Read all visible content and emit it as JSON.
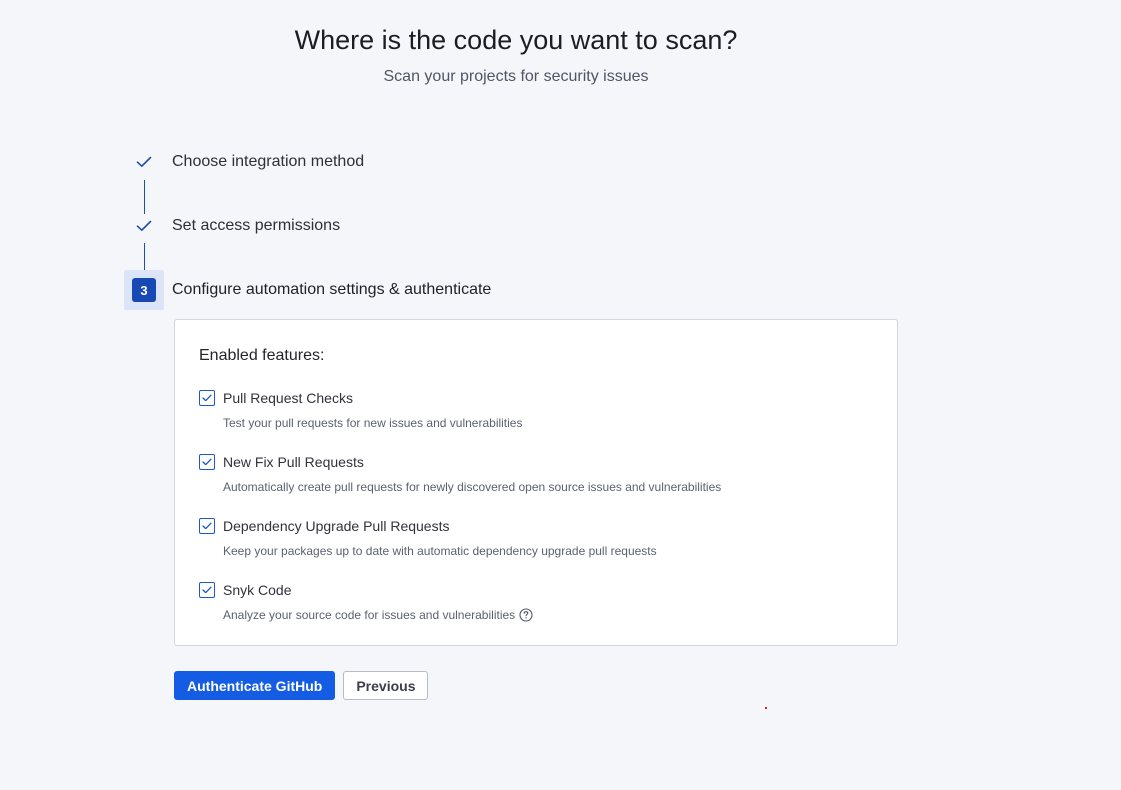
{
  "header": {
    "title": "Where is the code you want to scan?",
    "subtitle": "Scan your projects for security issues"
  },
  "steps": [
    {
      "label": "Choose integration method",
      "status": "completed",
      "icon": "check-icon"
    },
    {
      "label": "Set access permissions",
      "status": "completed",
      "icon": "check-icon"
    },
    {
      "label": "Configure automation settings & authenticate",
      "status": "active",
      "number": "3"
    }
  ],
  "features": {
    "heading": "Enabled features:",
    "items": [
      {
        "label": "Pull Request Checks",
        "description": "Test your pull requests for new issues and vulnerabilities",
        "checked": true
      },
      {
        "label": "New Fix Pull Requests",
        "description": "Automatically create pull requests for newly discovered open source issues and vulnerabilities",
        "checked": true
      },
      {
        "label": "Dependency Upgrade Pull Requests",
        "description": "Keep your packages up to date with automatic dependency upgrade pull requests",
        "checked": true
      },
      {
        "label": "Snyk Code",
        "description": "Analyze your source code for issues and vulnerabilities",
        "checked": true,
        "help_icon": "question-circle-icon"
      }
    ]
  },
  "actions": {
    "primary_label": "Authenticate GitHub",
    "secondary_label": "Previous"
  },
  "colors": {
    "background": "#f5f6fa",
    "accent": "#145ce3",
    "step_active": "#1748b3",
    "step_highlight": "#dbe4f8"
  }
}
